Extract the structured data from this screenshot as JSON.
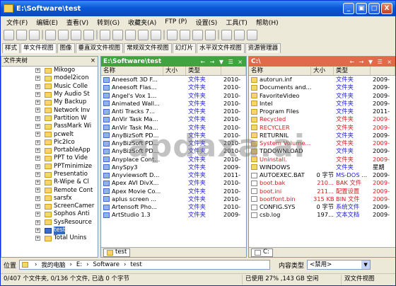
{
  "window": {
    "title": "E:\\Software\\test",
    "btn_min": "_",
    "btn_max": "□",
    "btn_restore": "▣",
    "btn_close": "X"
  },
  "menu": [
    "文件(F)",
    "编辑(E)",
    "查看(V)",
    "转到(G)",
    "收藏夹(A)",
    "FTP (P)",
    "设置(S)",
    "工具(T)",
    "帮助(H)"
  ],
  "tabs": [
    "样式",
    "单文件视图",
    "图像",
    "垂直双文件视图",
    "常规双文件视图",
    "幻灯片",
    "水平双文件视图",
    "资源管理器"
  ],
  "tree": {
    "header": "文件夹树",
    "close": "×",
    "items": [
      "Mikogo",
      "model2icon",
      "Music Colle",
      "My Audio St",
      "My Backup",
      "Network Inv",
      "Partition W",
      "PassMark Wi",
      "pcwelt",
      "Pic2Ico",
      "PortableApp",
      "PPT to Vide",
      "PPTminimize",
      "Presentatio",
      "R-Wipe & Cl",
      "Remote Cont",
      "sarsfx",
      "ScreenCamer",
      "Sophos Anti",
      "SysResource",
      "test",
      "Total Unins"
    ],
    "selected": 20
  },
  "left": {
    "path": "E:\\Software\\test",
    "navs": "← → ▼ ☰ ×",
    "cols": [
      "名称",
      "大小",
      "类型",
      ""
    ],
    "rows": [
      {
        "n": "Aneesoft 3D F...",
        "s": "",
        "t": "文件夹",
        "d": "2010-"
      },
      {
        "n": "Aneesoft Flas...",
        "s": "",
        "t": "文件夹",
        "d": "2010-"
      },
      {
        "n": "Angel's Vox 1...",
        "s": "",
        "t": "文件夹",
        "d": "2010-"
      },
      {
        "n": "Animated Wall...",
        "s": "",
        "t": "文件夹",
        "d": "2010-"
      },
      {
        "n": "Anti Tracks 7...",
        "s": "",
        "t": "文件夹",
        "d": "2010-"
      },
      {
        "n": "AnVir Task Ma...",
        "s": "",
        "t": "文件夹",
        "d": "2010-"
      },
      {
        "n": "AnVir Task Ma...",
        "s": "",
        "t": "文件夹",
        "d": "2010-"
      },
      {
        "n": "AnyBizSoft PD...",
        "s": "",
        "t": "文件夹",
        "d": "2010-"
      },
      {
        "n": "AnyBizSoft PD...",
        "s": "",
        "t": "文件夹",
        "d": "2010-"
      },
      {
        "n": "AnyBizSoft PD...",
        "s": "",
        "t": "文件夹",
        "d": "2010-"
      },
      {
        "n": "Anyplace Cont...",
        "s": "",
        "t": "文件夹",
        "d": "2010-"
      },
      {
        "n": "AnySpy3",
        "s": "",
        "t": "文件夹",
        "d": "2009-"
      },
      {
        "n": "Anyviewsoft D...",
        "s": "",
        "t": "文件夹",
        "d": "2011-"
      },
      {
        "n": "Apex AVI DivX...",
        "s": "",
        "t": "文件夹",
        "d": "2010-"
      },
      {
        "n": "Apex Movie Co...",
        "s": "",
        "t": "文件夹",
        "d": "2010-"
      },
      {
        "n": "aplus screen ...",
        "s": "",
        "t": "文件夹",
        "d": "2010-"
      },
      {
        "n": "Artensoft Pho...",
        "s": "",
        "t": "文件夹",
        "d": "2010-"
      },
      {
        "n": "ArtStudio 1.3",
        "s": "",
        "t": "文件夹",
        "d": "2009-"
      }
    ],
    "footer": "test"
  },
  "right": {
    "path": "C:\\",
    "navs": "← → ▼ ☰ ×",
    "cols": [
      "名称",
      "大小",
      "类型",
      ""
    ],
    "rows": [
      {
        "n": "autorun.inf",
        "s": "",
        "t": "文件夹",
        "d": "2009-",
        "c": ""
      },
      {
        "n": "Documents and...",
        "s": "",
        "t": "文件夹",
        "d": "2009-",
        "c": ""
      },
      {
        "n": "FavoriteVideo",
        "s": "",
        "t": "文件夹",
        "d": "2009-",
        "c": ""
      },
      {
        "n": "Intel",
        "s": "",
        "t": "文件夹",
        "d": "2009-",
        "c": ""
      },
      {
        "n": "Program Files",
        "s": "",
        "t": "文件夹",
        "d": "2011-",
        "c": ""
      },
      {
        "n": "Recycled",
        "s": "",
        "t": "文件夹",
        "d": "2009-",
        "c": "red"
      },
      {
        "n": "RECYCLER",
        "s": "",
        "t": "文件夹",
        "d": "2009-",
        "c": "red"
      },
      {
        "n": "RETURNIL",
        "s": "",
        "t": "文件夹",
        "d": "2009-",
        "c": ""
      },
      {
        "n": "System Volume...",
        "s": "",
        "t": "文件夹",
        "d": "2009-",
        "c": "red"
      },
      {
        "n": "TDDOWNLOAD",
        "s": "",
        "t": "文件夹",
        "d": "2009-",
        "c": ""
      },
      {
        "n": "Uninstall.",
        "s": "",
        "t": "文件夹",
        "d": "2009-",
        "c": "red"
      },
      {
        "n": "WINDOWS",
        "s": "",
        "t": "文件夹",
        "d": "星期",
        "c": ""
      },
      {
        "n": "AUTOEXEC.BAT",
        "s": "0 字节",
        "t": "MS-DOS ...",
        "d": "2009-",
        "c": ""
      },
      {
        "n": "boot.bak",
        "s": "210...",
        "t": "BAK 文件",
        "d": "2009-",
        "c": "red"
      },
      {
        "n": "boot.ini",
        "s": "211...",
        "t": "配置设置",
        "d": "2009-",
        "c": "red"
      },
      {
        "n": "bootfont.bin",
        "s": "315 KB",
        "t": "BIN 文件",
        "d": "2009-",
        "c": "red"
      },
      {
        "n": "CONFIG.SYS",
        "s": "0 字节",
        "t": "系统文件",
        "d": "2009-",
        "c": ""
      },
      {
        "n": "csb.log",
        "s": "197...",
        "t": "文本文档",
        "d": "2009-",
        "c": ""
      }
    ],
    "footer": "C:"
  },
  "address": {
    "label": "位置",
    "parts": [
      "我的电脑",
      "E:",
      "Software",
      "test"
    ],
    "type_label": "内容类型",
    "type_value": "<禁用>"
  },
  "status": {
    "left": "0/407 个文件夹, 0/136 个文件, 已选 0 个字节",
    "disk": "已使用 27% ,143 GB 空闲",
    "view": "双文件视图"
  },
  "watermark": "apdaxa.ai"
}
